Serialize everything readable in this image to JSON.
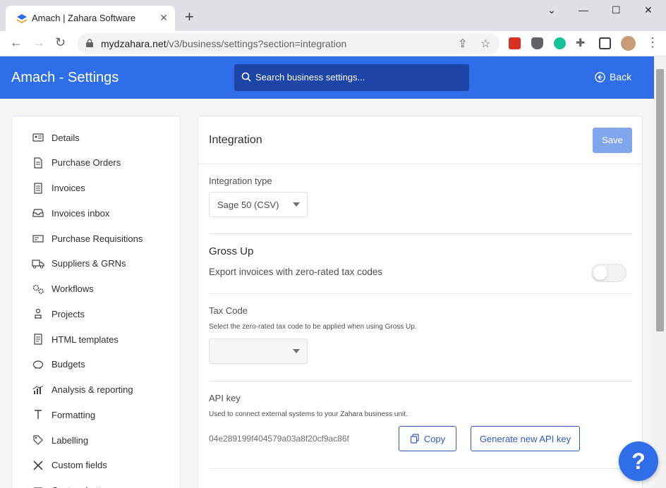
{
  "browser": {
    "tab_title": "Amach | Zahara Software",
    "tab_close": "✕",
    "new_tab": "+",
    "url_host": "mydzahara.net",
    "url_path": "/v3/business/settings?section=integration",
    "win_min": "—",
    "win_max": "☐",
    "win_close": "✕",
    "win_chevron": "⌄"
  },
  "header": {
    "title": "Amach - Settings",
    "search_placeholder": "Search business settings...",
    "back_label": "Back"
  },
  "sidebar": {
    "items": [
      {
        "label": "Details",
        "icon": "id-card-icon"
      },
      {
        "label": "Purchase Orders",
        "icon": "document-icon"
      },
      {
        "label": "Invoices",
        "icon": "invoice-icon"
      },
      {
        "label": "Invoices inbox",
        "icon": "inbox-icon"
      },
      {
        "label": "Purchase Requisitions",
        "icon": "requisition-icon"
      },
      {
        "label": "Suppliers & GRNs",
        "icon": "truck-icon"
      },
      {
        "label": "Workflows",
        "icon": "cogs-icon"
      },
      {
        "label": "Projects",
        "icon": "projects-icon"
      },
      {
        "label": "HTML templates",
        "icon": "template-icon"
      },
      {
        "label": "Budgets",
        "icon": "piggy-bank-icon"
      },
      {
        "label": "Analysis & reporting",
        "icon": "chart-icon"
      },
      {
        "label": "Formatting",
        "icon": "text-format-icon"
      },
      {
        "label": "Labelling",
        "icon": "tag-icon"
      },
      {
        "label": "Custom fields",
        "icon": "tools-icon"
      },
      {
        "label": "Custom buttons",
        "icon": "button-icon"
      }
    ]
  },
  "main": {
    "title": "Integration",
    "save_label": "Save",
    "integration_type_label": "Integration type",
    "integration_type_value": "Sage 50 (CSV)",
    "gross_up_title": "Gross Up",
    "gross_up_desc": "Export invoices with zero-rated tax codes",
    "gross_up_enabled": false,
    "tax_code_label": "Tax Code",
    "tax_code_help": "Select the zero-rated tax code to be applied when using Gross Up.",
    "tax_code_value": "",
    "api_key_label": "API key",
    "api_key_help": "Used to connect external systems to your Zahara business unit.",
    "api_key_value": "04e289199f404579a03a8f20cf9ac86f",
    "copy_label": "Copy",
    "generate_label": "Generate new API key"
  },
  "fab": {
    "label": "?"
  },
  "colors": {
    "brand_blue": "#2f6ee8",
    "search_bg": "#1d45a8",
    "save_disabled": "#82a6ee"
  }
}
